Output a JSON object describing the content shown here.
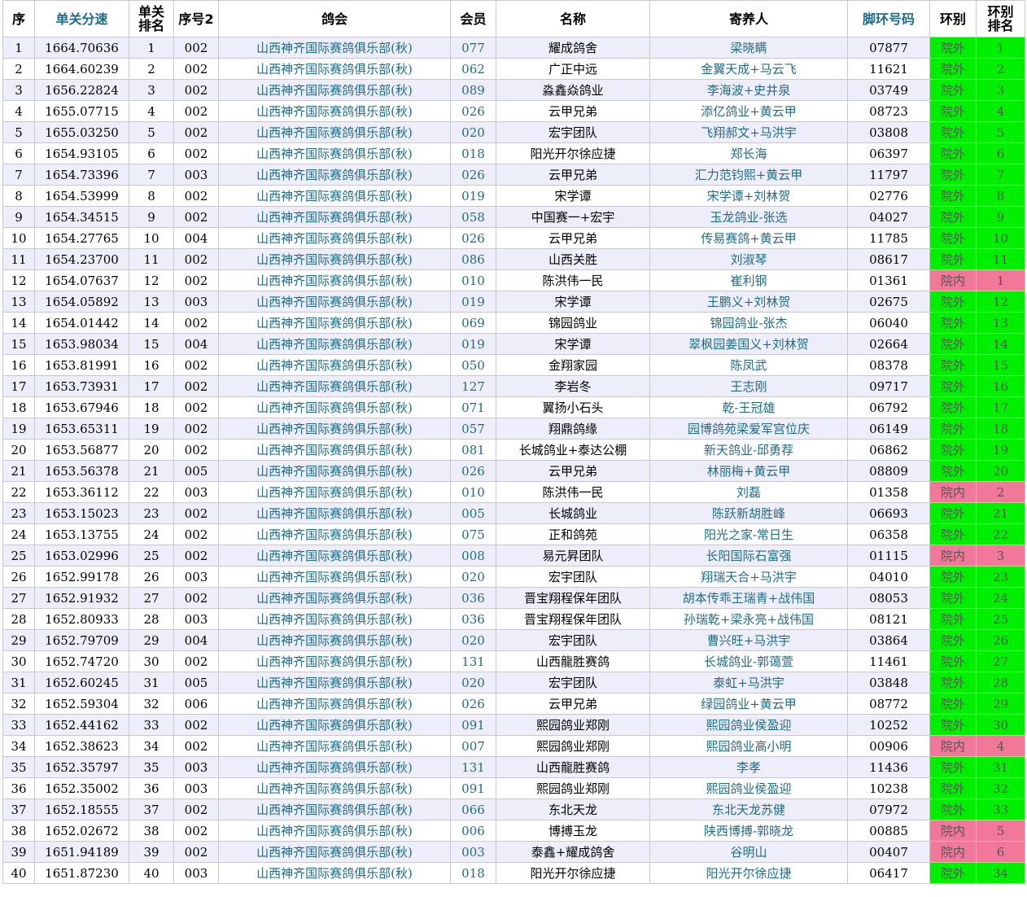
{
  "colors": {
    "zone_out": "#00ee00",
    "zone_in": "#f2789a",
    "link": "#1f6b86",
    "row_alt": "#eeeefa"
  },
  "headers": {
    "seq": "序",
    "speed": "单关分速",
    "rank_line1": "单关",
    "rank_line2": "排名",
    "seq2": "序号2",
    "club": "鸽会",
    "member": "会员",
    "name": "名称",
    "breeder": "寄养人",
    "ring": "脚环号码",
    "zone": "环别",
    "zone_rank_line1": "环别",
    "zone_rank_line2": "排名"
  },
  "rows": [
    {
      "seq": "1",
      "speed": "1664.70636",
      "rank": "1",
      "seq2": "002",
      "club": "山西神齐国际赛鸽俱乐部(秋)",
      "member": "077",
      "name": "耀成鸽舍",
      "breeder": "梁晓瞒",
      "ring": "07877",
      "zone": "院外",
      "zone_rank": "1"
    },
    {
      "seq": "2",
      "speed": "1664.60239",
      "rank": "2",
      "seq2": "002",
      "club": "山西神齐国际赛鸽俱乐部(秋)",
      "member": "062",
      "name": "广正中远",
      "breeder": "金翼天成+马云飞",
      "ring": "11621",
      "zone": "院外",
      "zone_rank": "2"
    },
    {
      "seq": "3",
      "speed": "1656.22824",
      "rank": "3",
      "seq2": "002",
      "club": "山西神齐国际赛鸽俱乐部(秋)",
      "member": "089",
      "name": "淼鑫焱鸽业",
      "breeder": "李海波+史井泉",
      "ring": "03749",
      "zone": "院外",
      "zone_rank": "3"
    },
    {
      "seq": "4",
      "speed": "1655.07715",
      "rank": "4",
      "seq2": "002",
      "club": "山西神齐国际赛鸽俱乐部(秋)",
      "member": "026",
      "name": "云甲兄弟",
      "breeder": "添亿鸽业+黄云甲",
      "ring": "08723",
      "zone": "院外",
      "zone_rank": "4"
    },
    {
      "seq": "5",
      "speed": "1655.03250",
      "rank": "5",
      "seq2": "002",
      "club": "山西神齐国际赛鸽俱乐部(秋)",
      "member": "020",
      "name": "宏宇团队",
      "breeder": "飞翔郝文+马洪宇",
      "ring": "03808",
      "zone": "院外",
      "zone_rank": "5"
    },
    {
      "seq": "6",
      "speed": "1654.93105",
      "rank": "6",
      "seq2": "002",
      "club": "山西神齐国际赛鸽俱乐部(秋)",
      "member": "018",
      "name": "阳光开尔徐应捷",
      "breeder": "郑长海",
      "ring": "06397",
      "zone": "院外",
      "zone_rank": "6"
    },
    {
      "seq": "7",
      "speed": "1654.73396",
      "rank": "7",
      "seq2": "003",
      "club": "山西神齐国际赛鸽俱乐部(秋)",
      "member": "026",
      "name": "云甲兄弟",
      "breeder": "汇力范钧熙+黄云甲",
      "ring": "11797",
      "zone": "院外",
      "zone_rank": "7"
    },
    {
      "seq": "8",
      "speed": "1654.53999",
      "rank": "8",
      "seq2": "002",
      "club": "山西神齐国际赛鸽俱乐部(秋)",
      "member": "019",
      "name": "宋学谭",
      "breeder": "宋学谭+刘林贺",
      "ring": "02776",
      "zone": "院外",
      "zone_rank": "8"
    },
    {
      "seq": "9",
      "speed": "1654.34515",
      "rank": "9",
      "seq2": "002",
      "club": "山西神齐国际赛鸽俱乐部(秋)",
      "member": "058",
      "name": "中国赛一+宏宇",
      "breeder": "玉龙鸽业-张选",
      "ring": "04027",
      "zone": "院外",
      "zone_rank": "9"
    },
    {
      "seq": "10",
      "speed": "1654.27765",
      "rank": "10",
      "seq2": "004",
      "club": "山西神齐国际赛鸽俱乐部(秋)",
      "member": "026",
      "name": "云甲兄弟",
      "breeder": "传易赛鸽+黄云甲",
      "ring": "11785",
      "zone": "院外",
      "zone_rank": "10"
    },
    {
      "seq": "11",
      "speed": "1654.23700",
      "rank": "11",
      "seq2": "002",
      "club": "山西神齐国际赛鸽俱乐部(秋)",
      "member": "086",
      "name": "山西关胜",
      "breeder": "刘淑琴",
      "ring": "08617",
      "zone": "院外",
      "zone_rank": "11"
    },
    {
      "seq": "12",
      "speed": "1654.07637",
      "rank": "12",
      "seq2": "002",
      "club": "山西神齐国际赛鸽俱乐部(秋)",
      "member": "010",
      "name": "陈洪伟一民",
      "breeder": "崔利钢",
      "ring": "01361",
      "zone": "院内",
      "zone_rank": "1"
    },
    {
      "seq": "13",
      "speed": "1654.05892",
      "rank": "13",
      "seq2": "003",
      "club": "山西神齐国际赛鸽俱乐部(秋)",
      "member": "019",
      "name": "宋学谭",
      "breeder": "王鹏义+刘林贺",
      "ring": "02675",
      "zone": "院外",
      "zone_rank": "12"
    },
    {
      "seq": "14",
      "speed": "1654.01442",
      "rank": "14",
      "seq2": "002",
      "club": "山西神齐国际赛鸽俱乐部(秋)",
      "member": "069",
      "name": "锦园鸽业",
      "breeder": "锦园鸽业-张杰",
      "ring": "06040",
      "zone": "院外",
      "zone_rank": "13"
    },
    {
      "seq": "15",
      "speed": "1653.98034",
      "rank": "15",
      "seq2": "004",
      "club": "山西神齐国际赛鸽俱乐部(秋)",
      "member": "019",
      "name": "宋学谭",
      "breeder": "翠枫园姜国义+刘林贺",
      "ring": "02664",
      "zone": "院外",
      "zone_rank": "14"
    },
    {
      "seq": "16",
      "speed": "1653.81991",
      "rank": "16",
      "seq2": "002",
      "club": "山西神齐国际赛鸽俱乐部(秋)",
      "member": "050",
      "name": "金翔家园",
      "breeder": "陈凤武",
      "ring": "08378",
      "zone": "院外",
      "zone_rank": "15"
    },
    {
      "seq": "17",
      "speed": "1653.73931",
      "rank": "17",
      "seq2": "002",
      "club": "山西神齐国际赛鸽俱乐部(秋)",
      "member": "127",
      "name": "李岩冬",
      "breeder": "王志刚",
      "ring": "09717",
      "zone": "院外",
      "zone_rank": "16"
    },
    {
      "seq": "18",
      "speed": "1653.67946",
      "rank": "18",
      "seq2": "002",
      "club": "山西神齐国际赛鸽俱乐部(秋)",
      "member": "071",
      "name": "翼扬小石头",
      "breeder": "乾-王冠雄",
      "ring": "06792",
      "zone": "院外",
      "zone_rank": "17"
    },
    {
      "seq": "19",
      "speed": "1653.65311",
      "rank": "19",
      "seq2": "002",
      "club": "山西神齐国际赛鸽俱乐部(秋)",
      "member": "057",
      "name": "翔鼎鸽缘",
      "breeder": "园博鸽苑梁爱军宫位庆",
      "ring": "06149",
      "zone": "院外",
      "zone_rank": "18"
    },
    {
      "seq": "20",
      "speed": "1653.56877",
      "rank": "20",
      "seq2": "002",
      "club": "山西神齐国际赛鸽俱乐部(秋)",
      "member": "081",
      "name": "长城鸽业+泰达公棚",
      "breeder": "新天鸽业-邱勇荐",
      "ring": "06862",
      "zone": "院外",
      "zone_rank": "19"
    },
    {
      "seq": "21",
      "speed": "1653.56378",
      "rank": "21",
      "seq2": "005",
      "club": "山西神齐国际赛鸽俱乐部(秋)",
      "member": "026",
      "name": "云甲兄弟",
      "breeder": "林丽梅+黄云甲",
      "ring": "08809",
      "zone": "院外",
      "zone_rank": "20"
    },
    {
      "seq": "22",
      "speed": "1653.36112",
      "rank": "22",
      "seq2": "003",
      "club": "山西神齐国际赛鸽俱乐部(秋)",
      "member": "010",
      "name": "陈洪伟一民",
      "breeder": "刘磊",
      "ring": "01358",
      "zone": "院内",
      "zone_rank": "2"
    },
    {
      "seq": "23",
      "speed": "1653.15023",
      "rank": "23",
      "seq2": "002",
      "club": "山西神齐国际赛鸽俱乐部(秋)",
      "member": "005",
      "name": "长城鸽业",
      "breeder": "陈跃新胡胜峰",
      "ring": "06693",
      "zone": "院外",
      "zone_rank": "21"
    },
    {
      "seq": "24",
      "speed": "1653.13755",
      "rank": "24",
      "seq2": "002",
      "club": "山西神齐国际赛鸽俱乐部(秋)",
      "member": "075",
      "name": "正和鸽苑",
      "breeder": "阳光之家-常日生",
      "ring": "06358",
      "zone": "院外",
      "zone_rank": "22"
    },
    {
      "seq": "25",
      "speed": "1653.02996",
      "rank": "25",
      "seq2": "002",
      "club": "山西神齐国际赛鸽俱乐部(秋)",
      "member": "008",
      "name": "易元昇团队",
      "breeder": "长阳国际石富强",
      "ring": "01115",
      "zone": "院内",
      "zone_rank": "3"
    },
    {
      "seq": "26",
      "speed": "1652.99178",
      "rank": "26",
      "seq2": "003",
      "club": "山西神齐国际赛鸽俱乐部(秋)",
      "member": "020",
      "name": "宏宇团队",
      "breeder": "翔瑞天合+马洪宇",
      "ring": "04010",
      "zone": "院外",
      "zone_rank": "23"
    },
    {
      "seq": "27",
      "speed": "1652.91932",
      "rank": "27",
      "seq2": "002",
      "club": "山西神齐国际赛鸽俱乐部(秋)",
      "member": "036",
      "name": "晋宝翔程保年团队",
      "breeder": "胡本传乖王瑞青+战伟国",
      "ring": "08053",
      "zone": "院外",
      "zone_rank": "24"
    },
    {
      "seq": "28",
      "speed": "1652.80933",
      "rank": "28",
      "seq2": "003",
      "club": "山西神齐国际赛鸽俱乐部(秋)",
      "member": "036",
      "name": "晋宝翔程保年团队",
      "breeder": "孙瑞乾+梁永亮+战伟国",
      "ring": "08121",
      "zone": "院外",
      "zone_rank": "25"
    },
    {
      "seq": "29",
      "speed": "1652.79709",
      "rank": "29",
      "seq2": "004",
      "club": "山西神齐国际赛鸽俱乐部(秋)",
      "member": "020",
      "name": "宏宇团队",
      "breeder": "曹兴旺+马洪宇",
      "ring": "03864",
      "zone": "院外",
      "zone_rank": "26"
    },
    {
      "seq": "30",
      "speed": "1652.74720",
      "rank": "30",
      "seq2": "002",
      "club": "山西神齐国际赛鸽俱乐部(秋)",
      "member": "131",
      "name": "山西龍胜赛鸽",
      "breeder": "长城鸽业-郭蔼萱",
      "ring": "11461",
      "zone": "院外",
      "zone_rank": "27"
    },
    {
      "seq": "31",
      "speed": "1652.60245",
      "rank": "31",
      "seq2": "005",
      "club": "山西神齐国际赛鸽俱乐部(秋)",
      "member": "020",
      "name": "宏宇团队",
      "breeder": "泰虹+马洪宇",
      "ring": "03848",
      "zone": "院外",
      "zone_rank": "28"
    },
    {
      "seq": "32",
      "speed": "1652.59304",
      "rank": "32",
      "seq2": "006",
      "club": "山西神齐国际赛鸽俱乐部(秋)",
      "member": "026",
      "name": "云甲兄弟",
      "breeder": "绿园鸽业+黄云甲",
      "ring": "08772",
      "zone": "院外",
      "zone_rank": "29"
    },
    {
      "seq": "33",
      "speed": "1652.44162",
      "rank": "33",
      "seq2": "002",
      "club": "山西神齐国际赛鸽俱乐部(秋)",
      "member": "091",
      "name": "熙园鸽业郑刚",
      "breeder": "熙园鸽业侯盈迎",
      "ring": "10252",
      "zone": "院外",
      "zone_rank": "30"
    },
    {
      "seq": "34",
      "speed": "1652.38623",
      "rank": "34",
      "seq2": "002",
      "club": "山西神齐国际赛鸽俱乐部(秋)",
      "member": "007",
      "name": "熙园鸽业郑刚",
      "breeder": "熙园鸽业高小明",
      "ring": "00906",
      "zone": "院内",
      "zone_rank": "4"
    },
    {
      "seq": "35",
      "speed": "1652.35797",
      "rank": "35",
      "seq2": "003",
      "club": "山西神齐国际赛鸽俱乐部(秋)",
      "member": "131",
      "name": "山西龍胜赛鸽",
      "breeder": "李孝",
      "ring": "11436",
      "zone": "院外",
      "zone_rank": "31"
    },
    {
      "seq": "36",
      "speed": "1652.35002",
      "rank": "36",
      "seq2": "003",
      "club": "山西神齐国际赛鸽俱乐部(秋)",
      "member": "091",
      "name": "熙园鸽业郑刚",
      "breeder": "熙园鸽业侯盈迎",
      "ring": "10238",
      "zone": "院外",
      "zone_rank": "32"
    },
    {
      "seq": "37",
      "speed": "1652.18555",
      "rank": "37",
      "seq2": "002",
      "club": "山西神齐国际赛鸽俱乐部(秋)",
      "member": "066",
      "name": "东北天龙",
      "breeder": "东北天龙苏健",
      "ring": "07972",
      "zone": "院外",
      "zone_rank": "33"
    },
    {
      "seq": "38",
      "speed": "1652.02672",
      "rank": "38",
      "seq2": "002",
      "club": "山西神齐国际赛鸽俱乐部(秋)",
      "member": "006",
      "name": "博搏玉龙",
      "breeder": "陕西博搏-郭晓龙",
      "ring": "00885",
      "zone": "院内",
      "zone_rank": "5"
    },
    {
      "seq": "39",
      "speed": "1651.94189",
      "rank": "39",
      "seq2": "002",
      "club": "山西神齐国际赛鸽俱乐部(秋)",
      "member": "003",
      "name": "泰鑫+耀成鸽舍",
      "breeder": "谷明山",
      "ring": "00407",
      "zone": "院内",
      "zone_rank": "6"
    },
    {
      "seq": "40",
      "speed": "1651.87230",
      "rank": "40",
      "seq2": "003",
      "club": "山西神齐国际赛鸽俱乐部(秋)",
      "member": "018",
      "name": "阳光开尔徐应捷",
      "breeder": "阳光开尔徐应捷",
      "ring": "06417",
      "zone": "院外",
      "zone_rank": "34"
    }
  ]
}
